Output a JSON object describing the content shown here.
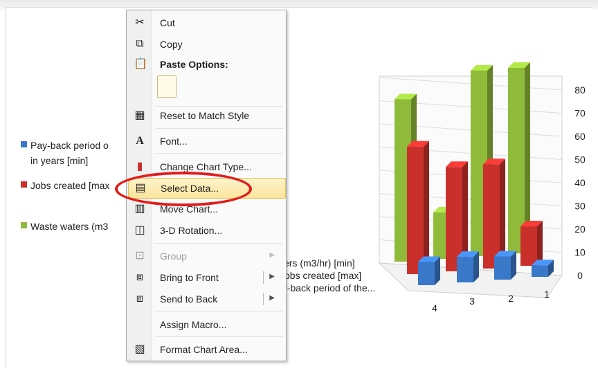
{
  "legend": [
    {
      "label_line1": "Pay-back period o",
      "label_line2": "in years [min]",
      "color": "#3a78c9"
    },
    {
      "label_line1": "Jobs created [max",
      "label_line2": "",
      "color": "#c9302c"
    },
    {
      "label_line1": "Waste waters (m3",
      "label_line2": "",
      "color": "#8fba3a"
    }
  ],
  "context_menu": {
    "items": [
      {
        "label": "Cut",
        "icon": "scissors-icon"
      },
      {
        "label": "Copy",
        "icon": "copy-icon"
      },
      {
        "label": "Paste Options:",
        "icon": "paste-icon"
      },
      {
        "label": "Reset to Match Style",
        "icon": "reset-style-icon"
      },
      {
        "label": "Font...",
        "icon": "font-icon"
      },
      {
        "label": "Change Chart Type...",
        "icon": "chart-type-icon"
      },
      {
        "label": "Select Data...",
        "icon": "select-data-icon"
      },
      {
        "label": "Move Chart...",
        "icon": "move-chart-icon"
      },
      {
        "label": "3-D Rotation...",
        "icon": "rotation-icon"
      },
      {
        "label": "Group",
        "icon": "group-icon"
      },
      {
        "label": "Bring to Front",
        "icon": "bring-front-icon"
      },
      {
        "label": "Send to Back",
        "icon": "send-back-icon"
      },
      {
        "label": "Assign Macro...",
        "icon": ""
      },
      {
        "label": "Format Chart Area...",
        "icon": "format-icon"
      }
    ]
  },
  "series_axis_labels": [
    "ers (m3/hr) [min]",
    "Jobs created [max]",
    "ay-back period of the..."
  ],
  "chart_data": {
    "type": "bar",
    "categories": [
      "4",
      "3",
      "2",
      "1"
    ],
    "series": [
      {
        "name": "Pay-back period of ... in years [min]",
        "values": [
          10,
          11,
          10,
          5
        ],
        "color": "#3a78c9"
      },
      {
        "name": "Jobs created [max]",
        "values": [
          55,
          45,
          45,
          17
        ],
        "color": "#c9302c"
      },
      {
        "name": "Waste waters (m3/hr) [min]",
        "values": [
          70,
          20,
          80,
          80
        ],
        "color": "#8fba3a"
      }
    ],
    "ylim": [
      0,
      80
    ],
    "yticks": [
      "0",
      "10",
      "20",
      "30",
      "40",
      "50",
      "60",
      "70",
      "80"
    ]
  }
}
